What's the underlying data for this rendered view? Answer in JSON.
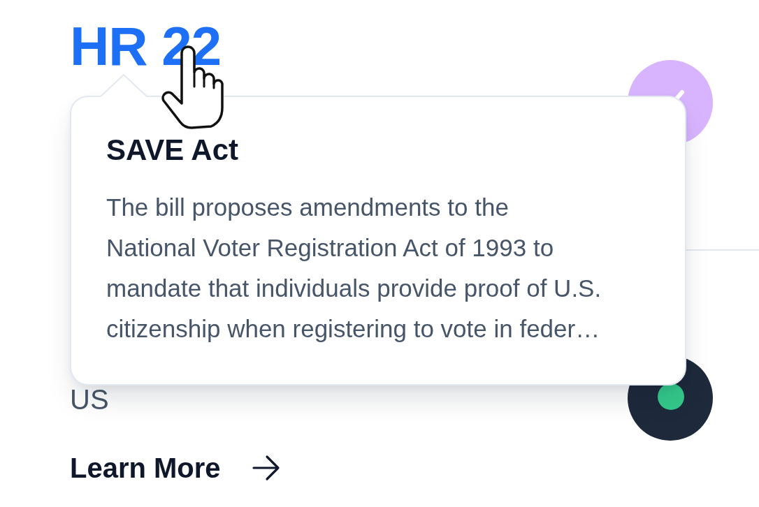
{
  "bill": {
    "number": "HR 22"
  },
  "sections": [
    {
      "indicator": {
        "kind": "check"
      }
    },
    {
      "label": "US",
      "indicator": {
        "kind": "dot"
      }
    }
  ],
  "link": {
    "label": "Learn More"
  },
  "tooltip": {
    "title": "SAVE Act",
    "text": "The bill proposes amendments to the National Voter Registration Act of 1993 to mandate that individuals provide proof of U.S. citizenship when registering to vote in feder…"
  }
}
